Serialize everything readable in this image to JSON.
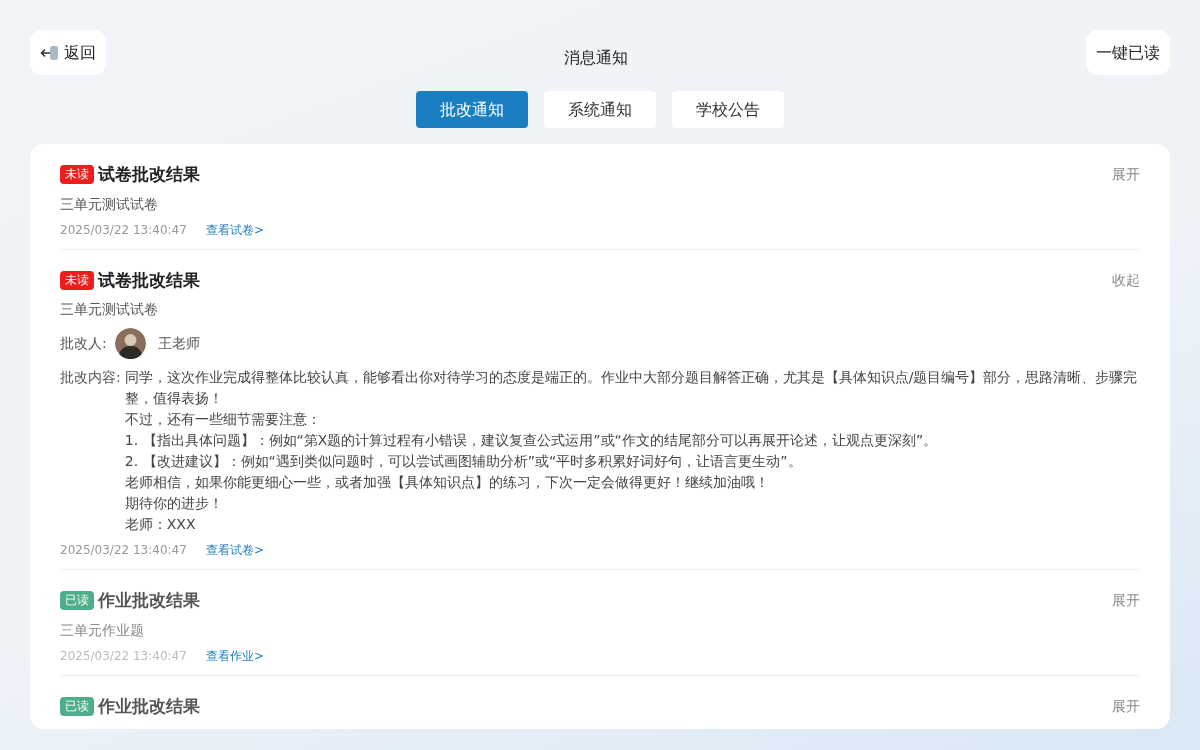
{
  "header": {
    "back_label": "返回",
    "title": "消息通知",
    "mark_all_label": "一键已读"
  },
  "tabs": [
    {
      "label": "批改通知",
      "selected": true
    },
    {
      "label": "系统通知",
      "selected": false
    },
    {
      "label": "学校公告",
      "selected": false
    }
  ],
  "notices": [
    {
      "badge": "未读",
      "read": false,
      "title": "试卷批改结果",
      "toggle": "展开",
      "subtitle": "三单元测试试卷",
      "time": "2025/03/22 13:40:47",
      "link": "查看试卷>"
    },
    {
      "badge": "未读",
      "read": false,
      "title": "试卷批改结果",
      "toggle": "收起",
      "subtitle": "三单元测试试卷",
      "reviewer_label": "批改人:",
      "reviewer": "王老师",
      "content_label": "批改内容:",
      "content_lines": [
        "同学，这次作业完成得整体比较认真，能够看出你对待学习的态度是端正的。作业中大部分题目解答正确，尤其是【具体知识点/题目编号】部分，思路清晰、步骤完整，值得表扬！",
        "不过，还有一些细节需要注意：",
        "1. 【指出具体问题】：例如“第X题的计算过程有小错误，建议复查公式运用”或“作文的结尾部分可以再展开论述，让观点更深刻”。",
        "2. 【改进建议】：例如“遇到类似问题时，可以尝试画图辅助分析”或“平时多积累好词好句，让语言更生动”。",
        "老师相信，如果你能更细心一些，或者加强【具体知识点】的练习，下次一定会做得更好！继续加油哦！",
        "期待你的进步！",
        "老师：XXX"
      ],
      "time": "2025/03/22 13:40:47",
      "link": "查看试卷>"
    },
    {
      "badge": "已读",
      "read": true,
      "title": "作业批改结果",
      "toggle": "展开",
      "subtitle": "三单元作业题",
      "time": "2025/03/22 13:40:47",
      "link": "查看作业>"
    },
    {
      "badge": "已读",
      "read": true,
      "title": "作业批改结果",
      "toggle": "展开"
    }
  ]
}
